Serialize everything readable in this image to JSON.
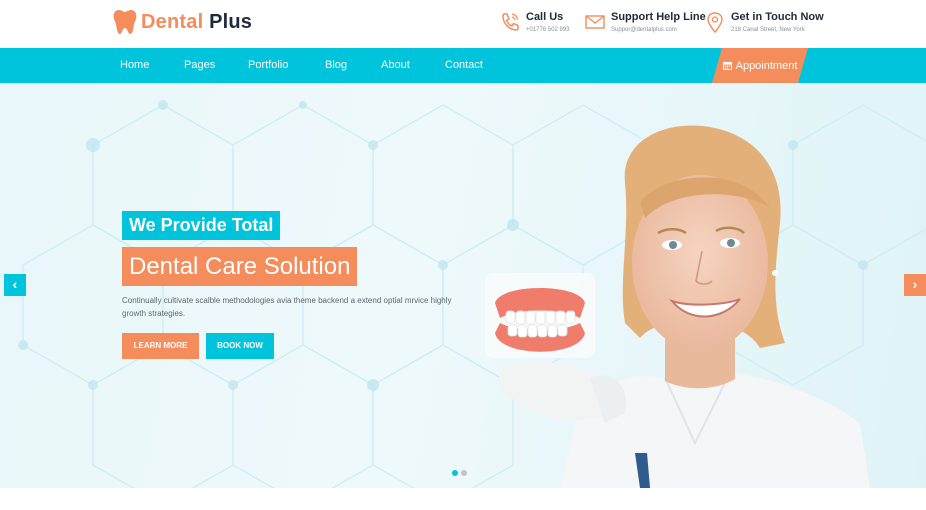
{
  "brand": {
    "name_first": "Dental",
    "name_second": "Plus"
  },
  "header": {
    "contacts": [
      {
        "title": "Call Us",
        "detail": "+01776 502 993",
        "icon": "phone-icon"
      },
      {
        "title": "Support Help Line",
        "detail": "Suppor@dentalplus.com",
        "icon": "envelope-icon"
      },
      {
        "title": "Get in Touch Now",
        "detail": "218 Canal Street, New York",
        "icon": "map-pin-icon"
      }
    ]
  },
  "nav": {
    "items": [
      "Home",
      "Pages",
      "Portfolio",
      "Blog",
      "About",
      "Contact"
    ],
    "appointment_label": "Appointment"
  },
  "hero": {
    "heading_line1": "We Provide Total",
    "heading_line2": "Dental Care Solution",
    "description": "Continually cultivate scalble methodologies avia theme backend a extend optial mrvice highly growth strategies.",
    "learn_more_label": "LEARN MORE",
    "book_now_label": "BOOK NOW",
    "prev_arrow": "‹",
    "next_arrow": "›"
  },
  "colors": {
    "accent_cyan": "#00c3dc",
    "accent_orange": "#f48c5c",
    "dark": "#1e2b3a"
  }
}
